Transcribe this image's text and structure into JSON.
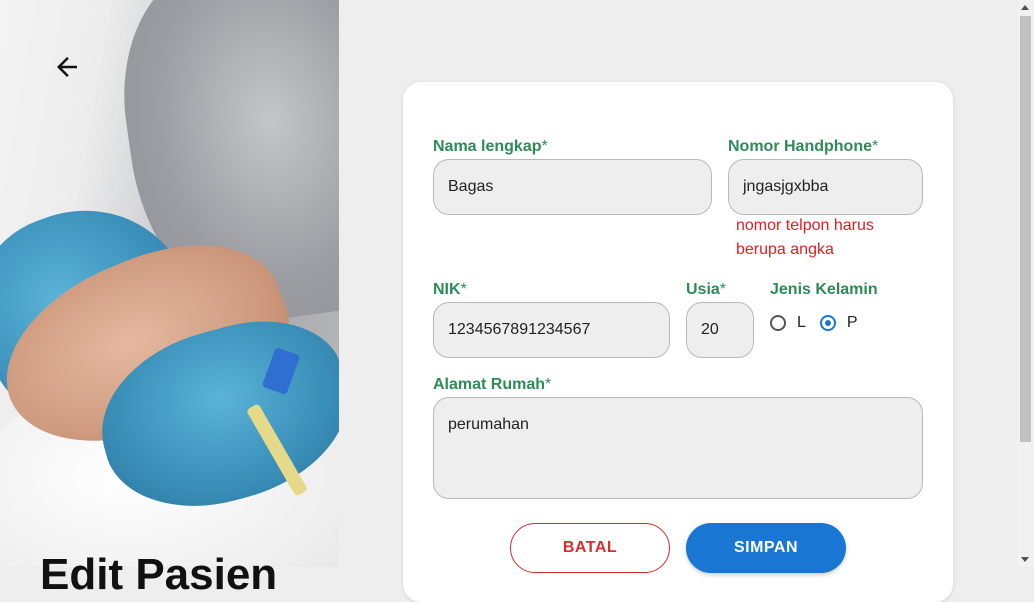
{
  "page": {
    "heading": "Edit Pasien"
  },
  "form": {
    "full_name": {
      "label": "Nama lengkap",
      "required_mark": "*",
      "value": "Bagas"
    },
    "phone": {
      "label": "Nomor Handphone",
      "required_mark": "*",
      "value": "jngasjgxbba",
      "error": "nomor telpon harus berupa angka"
    },
    "nik": {
      "label": "NIK",
      "required_mark": "*",
      "value": "1234567891234567"
    },
    "age": {
      "label": "Usia",
      "required_mark": "*",
      "value": "20"
    },
    "gender": {
      "label": "Jenis Kelamin",
      "options": [
        "L",
        "P"
      ],
      "selected": "P"
    },
    "address": {
      "label": "Alamat Rumah",
      "required_mark": "*",
      "value": "perumahan"
    }
  },
  "actions": {
    "cancel_label": "BATAL",
    "save_label": "SIMPAN"
  },
  "colors": {
    "label_green": "#2e8b57",
    "error_red": "#e02020",
    "primary_blue": "#1976d2",
    "cancel_red": "#d42e2e"
  },
  "icons": {
    "back": "arrow-left-icon"
  }
}
